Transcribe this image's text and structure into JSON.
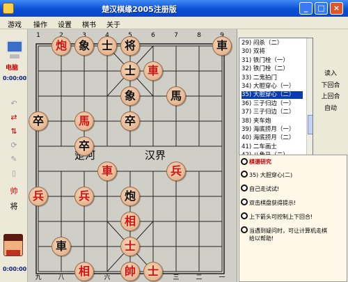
{
  "window": {
    "title": "楚汉棋缘2005注册版",
    "min": "_",
    "max": "□",
    "close": "×"
  },
  "menu": [
    "游戏",
    "操作",
    "设置",
    "棋书",
    "关于"
  ],
  "left": {
    "side_name": "电脑",
    "timer_top": "0:00:00",
    "timer_bottom": "0:00:00"
  },
  "board": {
    "top_numbers": [
      "1",
      "2",
      "3",
      "4",
      "5",
      "6",
      "7",
      "8",
      "9"
    ],
    "bottom_numbers": [
      "九",
      "八",
      "七",
      "六",
      "五",
      "四",
      "三",
      "二",
      "一"
    ],
    "river_left": "楚河",
    "river_right": "汉界",
    "pieces": [
      {
        "col": 1,
        "row": 0,
        "ch": "炮",
        "side": "red"
      },
      {
        "col": 2,
        "row": 0,
        "ch": "象",
        "side": "black"
      },
      {
        "col": 3,
        "row": 0,
        "ch": "士",
        "side": "black"
      },
      {
        "col": 4,
        "row": 0,
        "ch": "将",
        "side": "black"
      },
      {
        "col": 8,
        "row": 0,
        "ch": "車",
        "side": "black"
      },
      {
        "col": 4,
        "row": 1,
        "ch": "士",
        "side": "black"
      },
      {
        "col": 5,
        "row": 1,
        "ch": "車",
        "side": "red"
      },
      {
        "col": 4,
        "row": 2,
        "ch": "象",
        "side": "black"
      },
      {
        "col": 6,
        "row": 2,
        "ch": "馬",
        "side": "black"
      },
      {
        "col": 0,
        "row": 3,
        "ch": "卒",
        "side": "black"
      },
      {
        "col": 2,
        "row": 3,
        "ch": "馬",
        "side": "red"
      },
      {
        "col": 4,
        "row": 3,
        "ch": "卒",
        "side": "black"
      },
      {
        "col": 2,
        "row": 4,
        "ch": "卒",
        "side": "black"
      },
      {
        "col": 3,
        "row": 5,
        "ch": "車",
        "side": "red"
      },
      {
        "col": 6,
        "row": 5,
        "ch": "兵",
        "side": "red"
      },
      {
        "col": 0,
        "row": 6,
        "ch": "兵",
        "side": "red"
      },
      {
        "col": 2,
        "row": 6,
        "ch": "兵",
        "side": "red"
      },
      {
        "col": 4,
        "row": 6,
        "ch": "炮",
        "side": "black"
      },
      {
        "col": 4,
        "row": 7,
        "ch": "相",
        "side": "red"
      },
      {
        "col": 1,
        "row": 8,
        "ch": "車",
        "side": "black"
      },
      {
        "col": 4,
        "row": 8,
        "ch": "士",
        "side": "red"
      },
      {
        "col": 2,
        "row": 9,
        "ch": "相",
        "side": "red"
      },
      {
        "col": 4,
        "row": 9,
        "ch": "帥",
        "side": "red"
      },
      {
        "col": 5,
        "row": 9,
        "ch": "士",
        "side": "red"
      }
    ]
  },
  "moves": [
    "29) 闷杀（二）",
    "30) 双将",
    "31) 铁门栓（一）",
    "32) 铁门栓（二）",
    "33) 二鬼拍门",
    "34) 大胆穿心（一）",
    "35) 大胆穿心（二）",
    "36) 三子归边（一）",
    "37) 三子归边（二）",
    "38) 夹车炮",
    "39) 海底捞月（一）",
    "40) 海底捞月（二）",
    "41) 二车画士",
    "42) 八角马（二）"
  ],
  "selected_move": 6,
  "buttons": {
    "load": "读入",
    "next": "下回合",
    "prev": "上回合",
    "auto": "自动"
  },
  "tips": {
    "title": "棋谱研究",
    "lines": [
      "35) 大胆穿心(二)",
      "自己走试试!",
      "双击棋盘获得提示!",
      "上下箭头可控制上下回合!",
      "当遇到疑问时，可让计算机走棋",
      "给以帮助!"
    ]
  }
}
